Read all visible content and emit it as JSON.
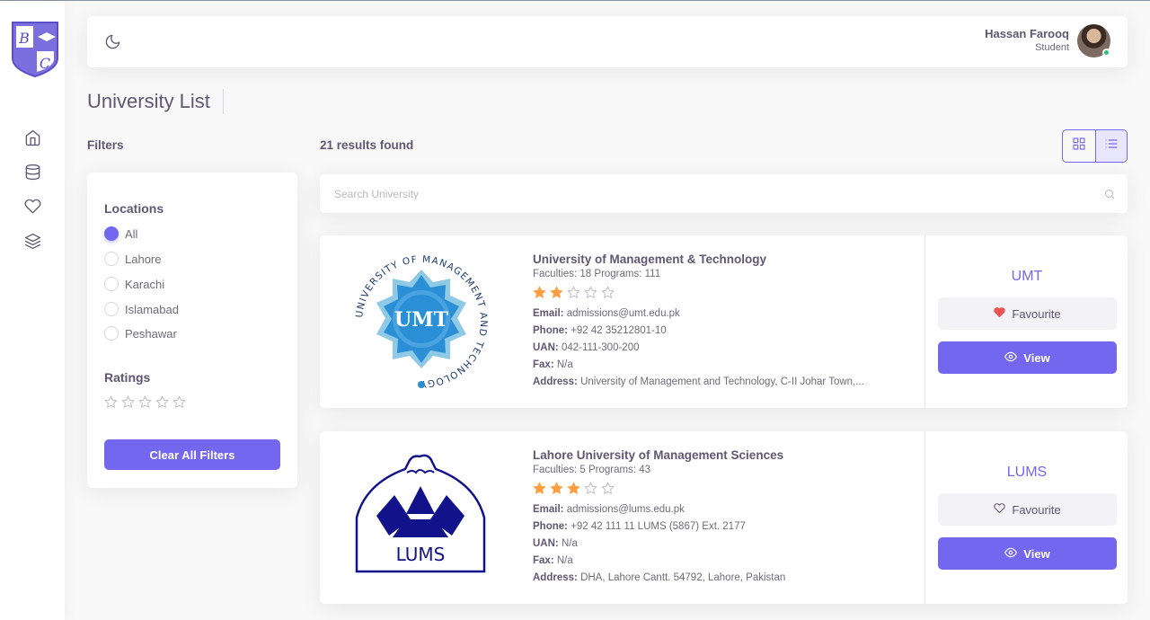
{
  "header": {
    "user_name": "Hassan Farooq",
    "user_role": "Student"
  },
  "page": {
    "title": "University List"
  },
  "filters": {
    "heading": "Filters",
    "locations_title": "Locations",
    "locations": [
      {
        "label": "All",
        "checked": true
      },
      {
        "label": "Lahore",
        "checked": false
      },
      {
        "label": "Karachi",
        "checked": false
      },
      {
        "label": "Islamabad",
        "checked": false
      },
      {
        "label": "Peshawar",
        "checked": false
      }
    ],
    "ratings_title": "Ratings",
    "ratings_stars": 5,
    "clear_label": "Clear All Filters"
  },
  "results": {
    "count_text": "21 results found",
    "search_placeholder": "Search University"
  },
  "colors": {
    "primary": "#7367f0",
    "star_filled": "#ff9f43",
    "heart": "#ea5455",
    "online": "#28c76f"
  },
  "universities": [
    {
      "name": "University of Management & Technology",
      "meta": "Faculties: 18 Programs: 111",
      "rating": 2,
      "email_label": "Email:",
      "email": "admissions@umt.edu.pk",
      "phone_label": "Phone:",
      "phone": "+92 42 35212801-10",
      "uan_label": "UAN:",
      "uan": "042-111-300-200",
      "fax_label": "Fax:",
      "fax": "N/a",
      "address_label": "Address:",
      "address": "University of Management and Technology, C-II Johar Town,...",
      "abbr": "UMT",
      "favourite_label": "Favourite",
      "favourited": true,
      "view_label": "View",
      "logo_text": "UMT",
      "logo_ring_text": "UNIVERSITY OF MANAGEMENT AND TECHNOLOGY"
    },
    {
      "name": "Lahore University of Management Sciences",
      "meta": "Faculties: 5 Programs: 43",
      "rating": 3,
      "email_label": "Email:",
      "email": "admissions@lums.edu.pk",
      "phone_label": "Phone:",
      "phone": "+92 42 111 11 LUMS (5867) Ext. 2177",
      "uan_label": "UAN:",
      "uan": "N/a",
      "fax_label": "Fax:",
      "fax": "N/a",
      "address_label": "Address:",
      "address": "DHA, Lahore Cantt. 54792, Lahore, Pakistan",
      "abbr": "LUMS",
      "favourite_label": "Favourite",
      "favourited": false,
      "view_label": "View",
      "logo_text": "LUMS"
    }
  ],
  "icons": {
    "sidebar": [
      "home-icon",
      "database-icon",
      "heart-icon",
      "layers-icon"
    ],
    "theme": "moon-icon",
    "grid_view": "grid-icon",
    "list_view": "list-icon",
    "search": "search-icon"
  }
}
